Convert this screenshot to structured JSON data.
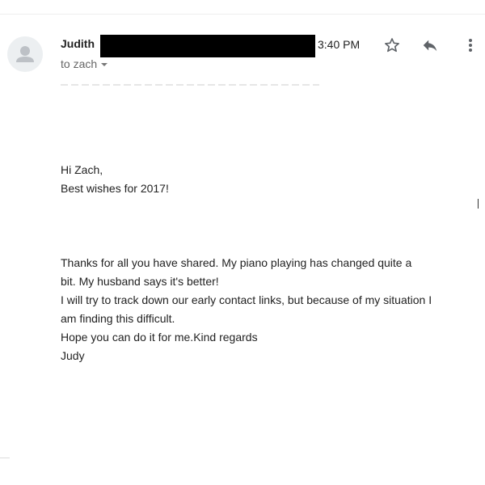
{
  "header": {
    "sender_name": "Judith",
    "time": "3:40 PM",
    "recipient": "to zach",
    "icons": {
      "avatar": "person-icon",
      "star": "star-outline-icon",
      "reply": "reply-icon",
      "more": "more-vert-icon",
      "recipient_toggle": "caret-down-icon"
    }
  },
  "message": {
    "greeting": [
      "Hi Zach,",
      "Best wishes for 2017!"
    ],
    "body": [
      "Thanks for all you have shared.  My piano playing has changed quite a",
      "bit.  My husband says it's better!",
      "I will try to track down our early contact links, but because of my situation I",
      "am finding this difficult.",
      "Hope you can do it for me.Kind regards",
      "Judy"
    ]
  },
  "colors": {
    "redaction": "#000000",
    "icon": "#5f6368",
    "avatar_bg": "#eceff1"
  }
}
